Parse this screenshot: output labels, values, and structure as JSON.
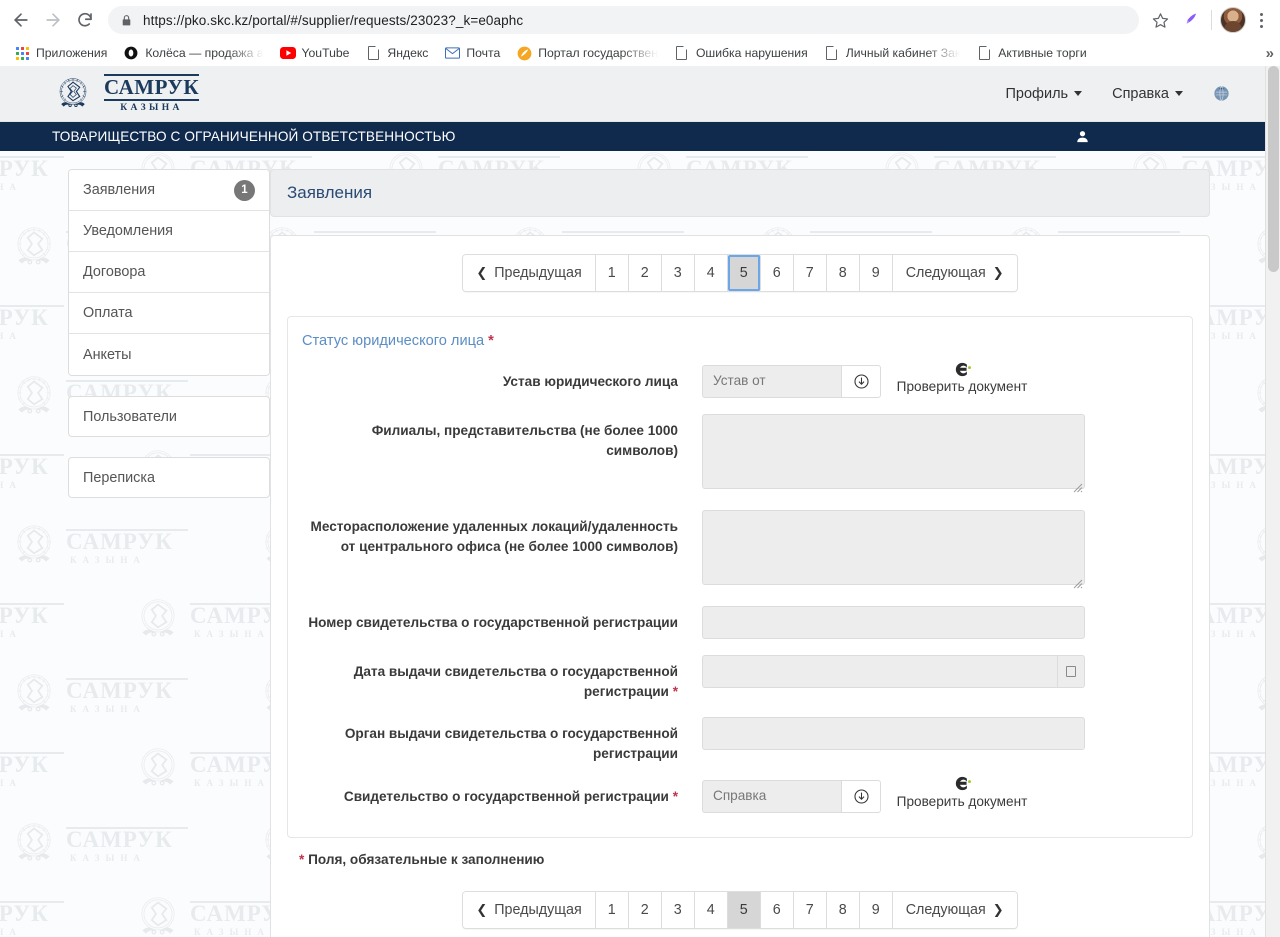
{
  "browser": {
    "back_icon": "back-arrow-icon",
    "forward_icon": "forward-arrow-icon",
    "reload_icon": "reload-icon",
    "lock_icon": "lock-icon",
    "url_scheme": "https://",
    "url_host": "pko.skc.kz",
    "url_path": "/portal/#/supplier/requests/23023?_k=e0aphc",
    "url_full": "https://pko.skc.kz/portal/#/supplier/requests/23023?_k=e0aphc",
    "star_icon": "bookmark-star-icon",
    "extension_icon": "pen-extension-icon",
    "profile_icon": "user-avatar",
    "menu_icon": "kebab-menu-icon",
    "bookmarks": [
      {
        "label": "Приложения",
        "icon": "apps-grid-icon"
      },
      {
        "label": "Колёса — продажа а",
        "icon": "koleса-favicon"
      },
      {
        "label": "YouTube",
        "icon": "youtube-icon"
      },
      {
        "label": "Яндекс",
        "icon": "document-icon"
      },
      {
        "label": "Почта",
        "icon": "mail-icon"
      },
      {
        "label": "Портал государствен",
        "icon": "egov-icon"
      },
      {
        "label": "Ошибка нарушения",
        "icon": "document-icon"
      },
      {
        "label": "Личный кабинет Зак",
        "icon": "document-icon"
      },
      {
        "label": "Активные торги",
        "icon": "document-icon"
      }
    ],
    "overflow_label": "»"
  },
  "site_header": {
    "logo_title": "САМРУК",
    "logo_subtitle": "КАЗЫНА",
    "nav": [
      {
        "label": "Профиль",
        "has_caret": true
      },
      {
        "label": "Справка",
        "has_caret": true
      }
    ],
    "language_icon": "globe-icon"
  },
  "org_bar": {
    "org_name": "ТОВАРИЩЕСТВО С ОГРАНИЧЕННОЙ ОТВЕТСТВЕННОСТЬЮ",
    "user_icon": "user-icon"
  },
  "sidebar": {
    "group1": [
      {
        "label": "Заявления",
        "badge": "1"
      },
      {
        "label": "Уведомления",
        "badge": ""
      },
      {
        "label": "Договора",
        "badge": ""
      },
      {
        "label": "Оплата",
        "badge": ""
      },
      {
        "label": "Анкеты",
        "badge": ""
      }
    ],
    "group2": {
      "label": "Пользователи"
    },
    "group3": {
      "label": "Переписка"
    }
  },
  "main": {
    "page_title": "Заявления",
    "pager": {
      "prev_label": "Предыдущая",
      "next_label": "Следующая",
      "prev_icon": "chevron-left-icon",
      "next_icon": "chevron-right-icon",
      "pages": [
        "1",
        "2",
        "3",
        "4",
        "5",
        "6",
        "7",
        "8",
        "9"
      ],
      "active_page": "5"
    },
    "form": {
      "legend": "Статус юридического лица",
      "fields": [
        {
          "label": "Устав юридического лица",
          "required": false,
          "type": "file",
          "value": "Устав от",
          "download_icon": "download-icon",
          "verify_label": "Проверить документ",
          "verify_icon": "check-document-logo-icon"
        },
        {
          "label": "Филиалы, представительства (не более 1000 символов)",
          "required": false,
          "type": "textarea",
          "value": ""
        },
        {
          "label": "Месторасположение удаленных локаций/удаленность от центрального офиса (не более 1000 символов)",
          "required": false,
          "type": "textarea",
          "value": ""
        },
        {
          "label": "Номер свидетельства о государственной регистрации",
          "required": false,
          "type": "text",
          "value": ""
        },
        {
          "label": "Дата выдачи свидетельства о государственной регистрации",
          "required": true,
          "type": "date",
          "value": "",
          "calendar_icon": "calendar-icon"
        },
        {
          "label": "Орган выдачи свидетельства о государственной регистрации",
          "required": false,
          "type": "text",
          "value": ""
        },
        {
          "label": "Свидетельство о государственной регистрации",
          "required": true,
          "type": "file",
          "value": "Справка",
          "download_icon": "download-icon",
          "verify_label": "Проверить документ",
          "verify_icon": "check-document-logo-icon"
        }
      ],
      "footnote": "Поля, обязательные к заполнению"
    }
  },
  "colors": {
    "org_bar": "#102a4d",
    "legend_blue": "#5b8ec4",
    "required_red": "#c0334b",
    "active_page_bg": "#d6d6d6",
    "focus_ring": "#6aa6e8"
  }
}
